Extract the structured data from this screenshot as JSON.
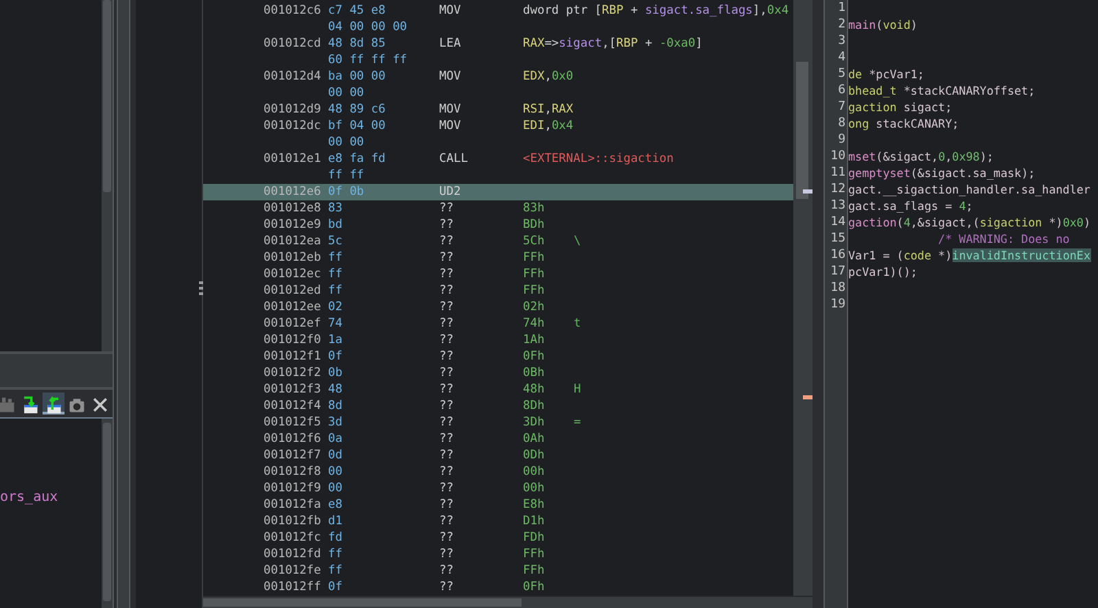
{
  "left_panel": {
    "toolbar": [
      {
        "kind": "plugin",
        "selected": false
      },
      {
        "kind": "import",
        "selected": false
      },
      {
        "kind": "export",
        "selected": true
      },
      {
        "kind": "snapshot",
        "selected": false
      },
      {
        "kind": "close",
        "selected": false
      }
    ],
    "symbol_text": "ors_aux"
  },
  "listing": {
    "rows": [
      {
        "kind": "instruction",
        "address": "001012c6",
        "bytes": "c7 45 e8",
        "mnemonic": "MOV",
        "operands": [
          {
            "text": "dword ptr [",
            "kind": "plain"
          },
          {
            "text": "RBP",
            "kind": "register"
          },
          {
            "text": " + ",
            "kind": "plain"
          },
          {
            "text": "sigact.sa_flags",
            "kind": "variable"
          },
          {
            "text": "],",
            "kind": "plain"
          },
          {
            "text": "0x4",
            "kind": "scalar"
          }
        ],
        "selected": false
      },
      {
        "kind": "continuation",
        "bytes": "04 00 00 00"
      },
      {
        "kind": "instruction",
        "address": "001012cd",
        "bytes": "48 8d 85",
        "mnemonic": "LEA",
        "operands": [
          {
            "text": "RAX",
            "kind": "register"
          },
          {
            "text": "=>",
            "kind": "plain"
          },
          {
            "text": "sigact",
            "kind": "variable"
          },
          {
            "text": ",[",
            "kind": "plain"
          },
          {
            "text": "RBP",
            "kind": "register"
          },
          {
            "text": " + ",
            "kind": "plain"
          },
          {
            "text": "-0xa0",
            "kind": "scalar"
          },
          {
            "text": "]",
            "kind": "plain"
          }
        ],
        "selected": false
      },
      {
        "kind": "continuation",
        "bytes": "60 ff ff ff"
      },
      {
        "kind": "instruction",
        "address": "001012d4",
        "bytes": "ba 00 00",
        "mnemonic": "MOV",
        "operands": [
          {
            "text": "EDX",
            "kind": "register"
          },
          {
            "text": ",",
            "kind": "plain"
          },
          {
            "text": "0x0",
            "kind": "scalar"
          }
        ],
        "selected": false
      },
      {
        "kind": "continuation",
        "bytes": "00 00"
      },
      {
        "kind": "instruction",
        "address": "001012d9",
        "bytes": "48 89 c6",
        "mnemonic": "MOV",
        "operands": [
          {
            "text": "RSI",
            "kind": "register"
          },
          {
            "text": ",",
            "kind": "plain"
          },
          {
            "text": "RAX",
            "kind": "register"
          }
        ],
        "selected": false
      },
      {
        "kind": "instruction",
        "address": "001012dc",
        "bytes": "bf 04 00",
        "mnemonic": "MOV",
        "operands": [
          {
            "text": "EDI",
            "kind": "register"
          },
          {
            "text": ",",
            "kind": "plain"
          },
          {
            "text": "0x4",
            "kind": "scalar"
          }
        ],
        "selected": false
      },
      {
        "kind": "continuation",
        "bytes": "00 00"
      },
      {
        "kind": "instruction",
        "address": "001012e1",
        "bytes": "e8 fa fd",
        "mnemonic": "CALL",
        "operands": [
          {
            "text": "<EXTERNAL>::sigaction",
            "kind": "external"
          }
        ],
        "selected": false
      },
      {
        "kind": "continuation",
        "bytes": "ff ff"
      },
      {
        "kind": "instruction",
        "address": "001012e6",
        "bytes": "0f 0b",
        "mnemonic": "UD2",
        "operands": [],
        "selected": true
      },
      {
        "kind": "instruction",
        "address": "001012e8",
        "bytes": "83",
        "mnemonic": "??",
        "operands": [
          {
            "text": "83h",
            "kind": "scalar"
          }
        ],
        "selected": false
      },
      {
        "kind": "instruction",
        "address": "001012e9",
        "bytes": "bd",
        "mnemonic": "??",
        "operands": [
          {
            "text": "BDh",
            "kind": "scalar"
          }
        ],
        "selected": false
      },
      {
        "kind": "instruction",
        "address": "001012ea",
        "bytes": "5c",
        "mnemonic": "??",
        "operands": [
          {
            "text": "5Ch",
            "kind": "scalar"
          }
        ],
        "char": "\\",
        "selected": false
      },
      {
        "kind": "instruction",
        "address": "001012eb",
        "bytes": "ff",
        "mnemonic": "??",
        "operands": [
          {
            "text": "FFh",
            "kind": "scalar"
          }
        ],
        "selected": false
      },
      {
        "kind": "instruction",
        "address": "001012ec",
        "bytes": "ff",
        "mnemonic": "??",
        "operands": [
          {
            "text": "FFh",
            "kind": "scalar"
          }
        ],
        "selected": false
      },
      {
        "kind": "instruction",
        "address": "001012ed",
        "bytes": "ff",
        "mnemonic": "??",
        "operands": [
          {
            "text": "FFh",
            "kind": "scalar"
          }
        ],
        "selected": false
      },
      {
        "kind": "instruction",
        "address": "001012ee",
        "bytes": "02",
        "mnemonic": "??",
        "operands": [
          {
            "text": "02h",
            "kind": "scalar"
          }
        ],
        "selected": false
      },
      {
        "kind": "instruction",
        "address": "001012ef",
        "bytes": "74",
        "mnemonic": "??",
        "operands": [
          {
            "text": "74h",
            "kind": "scalar"
          }
        ],
        "char": "t",
        "selected": false
      },
      {
        "kind": "instruction",
        "address": "001012f0",
        "bytes": "1a",
        "mnemonic": "??",
        "operands": [
          {
            "text": "1Ah",
            "kind": "scalar"
          }
        ],
        "selected": false
      },
      {
        "kind": "instruction",
        "address": "001012f1",
        "bytes": "0f",
        "mnemonic": "??",
        "operands": [
          {
            "text": "0Fh",
            "kind": "scalar"
          }
        ],
        "selected": false
      },
      {
        "kind": "instruction",
        "address": "001012f2",
        "bytes": "0b",
        "mnemonic": "??",
        "operands": [
          {
            "text": "0Bh",
            "kind": "scalar"
          }
        ],
        "selected": false
      },
      {
        "kind": "instruction",
        "address": "001012f3",
        "bytes": "48",
        "mnemonic": "??",
        "operands": [
          {
            "text": "48h",
            "kind": "scalar"
          }
        ],
        "char": "H",
        "selected": false
      },
      {
        "kind": "instruction",
        "address": "001012f4",
        "bytes": "8d",
        "mnemonic": "??",
        "operands": [
          {
            "text": "8Dh",
            "kind": "scalar"
          }
        ],
        "selected": false
      },
      {
        "kind": "instruction",
        "address": "001012f5",
        "bytes": "3d",
        "mnemonic": "??",
        "operands": [
          {
            "text": "3Dh",
            "kind": "scalar"
          }
        ],
        "char": "=",
        "selected": false
      },
      {
        "kind": "instruction",
        "address": "001012f6",
        "bytes": "0a",
        "mnemonic": "??",
        "operands": [
          {
            "text": "0Ah",
            "kind": "scalar"
          }
        ],
        "selected": false
      },
      {
        "kind": "instruction",
        "address": "001012f7",
        "bytes": "0d",
        "mnemonic": "??",
        "operands": [
          {
            "text": "0Dh",
            "kind": "scalar"
          }
        ],
        "selected": false
      },
      {
        "kind": "instruction",
        "address": "001012f8",
        "bytes": "00",
        "mnemonic": "??",
        "operands": [
          {
            "text": "00h",
            "kind": "scalar"
          }
        ],
        "selected": false
      },
      {
        "kind": "instruction",
        "address": "001012f9",
        "bytes": "00",
        "mnemonic": "??",
        "operands": [
          {
            "text": "00h",
            "kind": "scalar"
          }
        ],
        "selected": false
      },
      {
        "kind": "instruction",
        "address": "001012fa",
        "bytes": "e8",
        "mnemonic": "??",
        "operands": [
          {
            "text": "E8h",
            "kind": "scalar"
          }
        ],
        "selected": false
      },
      {
        "kind": "instruction",
        "address": "001012fb",
        "bytes": "d1",
        "mnemonic": "??",
        "operands": [
          {
            "text": "D1h",
            "kind": "scalar"
          }
        ],
        "selected": false
      },
      {
        "kind": "instruction",
        "address": "001012fc",
        "bytes": "fd",
        "mnemonic": "??",
        "operands": [
          {
            "text": "FDh",
            "kind": "scalar"
          }
        ],
        "selected": false
      },
      {
        "kind": "instruction",
        "address": "001012fd",
        "bytes": "ff",
        "mnemonic": "??",
        "operands": [
          {
            "text": "FFh",
            "kind": "scalar"
          }
        ],
        "selected": false
      },
      {
        "kind": "instruction",
        "address": "001012fe",
        "bytes": "ff",
        "mnemonic": "??",
        "operands": [
          {
            "text": "FFh",
            "kind": "scalar"
          }
        ],
        "selected": false
      },
      {
        "kind": "instruction",
        "address": "001012ff",
        "bytes": "0f",
        "mnemonic": "??",
        "operands": [
          {
            "text": "0Fh",
            "kind": "scalar"
          }
        ],
        "selected": false
      }
    ]
  },
  "decompiler": {
    "lines": [
      {
        "number": "1"
      },
      {
        "number": "2",
        "segments": [
          {
            "text": "main",
            "kind": "function"
          },
          {
            "text": "(",
            "kind": "plain"
          },
          {
            "text": "void",
            "kind": "type"
          },
          {
            "text": ")",
            "kind": "plain"
          }
        ]
      },
      {
        "number": "3"
      },
      {
        "number": "4"
      },
      {
        "number": "5",
        "segments": [
          {
            "text": "de",
            "kind": "type"
          },
          {
            "text": " *pcVar1;",
            "kind": "plain"
          }
        ]
      },
      {
        "number": "6",
        "segments": [
          {
            "text": "bhead_t",
            "kind": "type"
          },
          {
            "text": " *stackCANARYoffset;",
            "kind": "plain"
          }
        ]
      },
      {
        "number": "7",
        "segments": [
          {
            "text": "gaction",
            "kind": "type"
          },
          {
            "text": " sigact;",
            "kind": "plain"
          }
        ]
      },
      {
        "number": "8",
        "segments": [
          {
            "text": "ong",
            "kind": "type"
          },
          {
            "text": " stackCANARY;",
            "kind": "plain"
          }
        ]
      },
      {
        "number": "9"
      },
      {
        "number": "10",
        "segments": [
          {
            "text": "mset",
            "kind": "function"
          },
          {
            "text": "(&sigact,",
            "kind": "plain"
          },
          {
            "text": "0",
            "kind": "number"
          },
          {
            "text": ",",
            "kind": "plain"
          },
          {
            "text": "0x98",
            "kind": "number"
          },
          {
            "text": ");",
            "kind": "plain"
          }
        ]
      },
      {
        "number": "11",
        "segments": [
          {
            "text": "gemptyset",
            "kind": "function"
          },
          {
            "text": "(&sigact.sa_mask);",
            "kind": "plain"
          }
        ]
      },
      {
        "number": "12",
        "segments": [
          {
            "text": "gact.__sigaction_handler.sa_handler",
            "kind": "plain"
          }
        ]
      },
      {
        "number": "13",
        "segments": [
          {
            "text": "gact.sa_flags = ",
            "kind": "plain"
          },
          {
            "text": "4",
            "kind": "number"
          },
          {
            "text": ";",
            "kind": "plain"
          }
        ]
      },
      {
        "number": "14",
        "segments": [
          {
            "text": "gaction",
            "kind": "function"
          },
          {
            "text": "(",
            "kind": "plain"
          },
          {
            "text": "4",
            "kind": "number"
          },
          {
            "text": ",&sigact,(",
            "kind": "plain"
          },
          {
            "text": "sigaction",
            "kind": "type"
          },
          {
            "text": " *)",
            "kind": "plain"
          },
          {
            "text": "0x0",
            "kind": "number"
          },
          {
            "text": ")",
            "kind": "plain"
          }
        ]
      },
      {
        "number": "15",
        "segments": [
          {
            "text": "             /* WARNING: Does no",
            "kind": "comment"
          }
        ]
      },
      {
        "number": "16",
        "segments": [
          {
            "text": "Var1 = (",
            "kind": "plain"
          },
          {
            "text": "code",
            "kind": "type"
          },
          {
            "text": " *)",
            "kind": "plain"
          },
          {
            "text": "invalidInstructionEx",
            "kind": "highlight"
          }
        ]
      },
      {
        "number": "17",
        "segments": [
          {
            "text": "pcVar1)();",
            "kind": "plain"
          }
        ]
      },
      {
        "number": "18"
      },
      {
        "number": "19"
      }
    ]
  }
}
